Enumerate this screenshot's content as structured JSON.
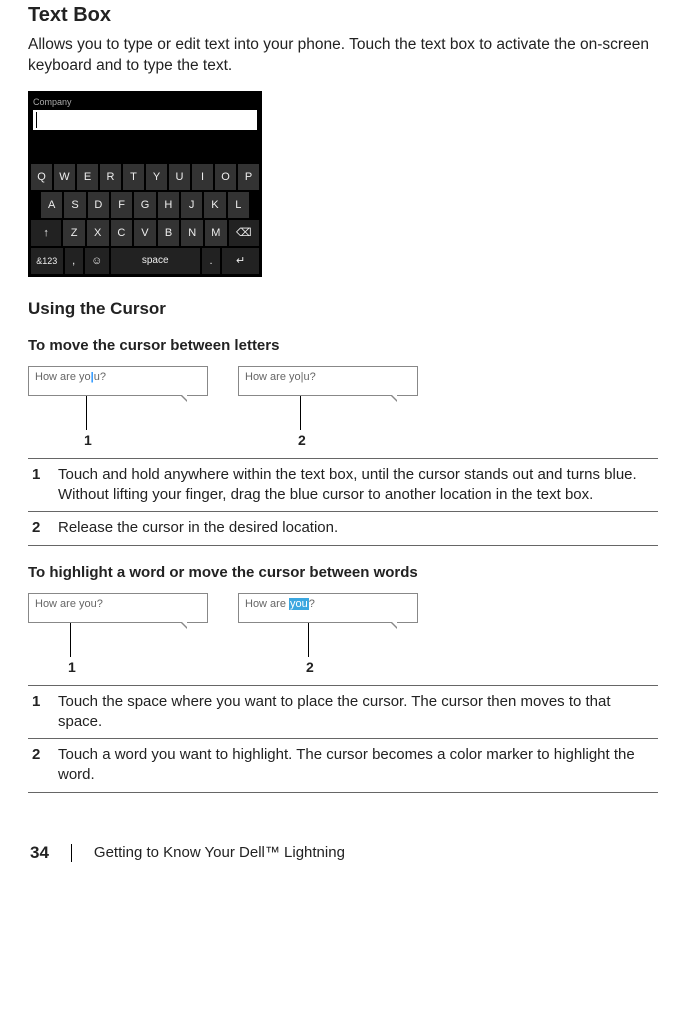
{
  "headings": {
    "textBox": "Text Box",
    "usingCursor": "Using the Cursor",
    "moveLetters": "To move the cursor between letters",
    "highlightWords": "To highlight a word or move the cursor between words"
  },
  "paragraphs": {
    "textBoxDesc": "Allows you to type or edit text into your phone. Touch the text box to activate the on-screen keyboard and to type the text."
  },
  "phone": {
    "fieldLabel": "Company",
    "rows": {
      "r1": [
        "Q",
        "W",
        "E",
        "R",
        "T",
        "Y",
        "U",
        "I",
        "O",
        "P"
      ],
      "r2": [
        "A",
        "S",
        "D",
        "F",
        "G",
        "H",
        "J",
        "K",
        "L"
      ],
      "r3_letters": [
        "Z",
        "X",
        "C",
        "V",
        "B",
        "N",
        "M"
      ],
      "sym": "&123",
      "comma": ",",
      "space": "space",
      "period": "."
    }
  },
  "illus": {
    "sample": "How are you?",
    "pre": "How are yo",
    "post": "u?",
    "hw_pre": "How are ",
    "hw_word": "you",
    "hw_post": "?",
    "n1": "1",
    "n2": "2"
  },
  "stepsLetters": [
    {
      "n": "1",
      "t": "Touch and hold anywhere within the text box, until the cursor stands out and turns blue. Without lifting your finger, drag the blue cursor to another location in the text box."
    },
    {
      "n": "2",
      "t": "Release the cursor in the desired location."
    }
  ],
  "stepsWords": [
    {
      "n": "1",
      "t": "Touch the space where you want to place the cursor. The cursor then moves to that space."
    },
    {
      "n": "2",
      "t": "Touch a word you want to highlight. The cursor becomes a color marker to highlight the word."
    }
  ],
  "footer": {
    "page": "34",
    "chapter": "Getting to Know Your Dell™ Lightning"
  }
}
